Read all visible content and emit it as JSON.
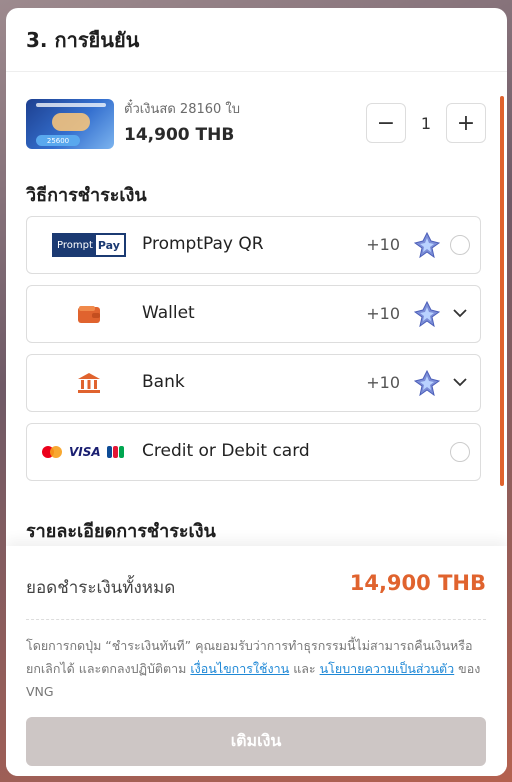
{
  "header": {
    "title": "3. การยืนยัน"
  },
  "product": {
    "name": "ตั๋วเงินสด 28160 ใบ",
    "price": "14,900 THB",
    "thumb_badge": "25600",
    "quantity": "1",
    "minus_label": "−",
    "plus_label": "+"
  },
  "payment": {
    "section_title": "วิธีการชำระเงิน",
    "methods": [
      {
        "label": "PromptPay QR",
        "bonus": "+10",
        "logo_text_a": "Prompt",
        "logo_text_b": "Pay",
        "control": "radio"
      },
      {
        "label": "Wallet",
        "bonus": "+10",
        "icon": "wallet-icon",
        "control": "chevron"
      },
      {
        "label": "Bank",
        "bonus": "+10",
        "icon": "bank-icon",
        "control": "chevron"
      },
      {
        "label": "Credit or Debit card",
        "logo_visa": "VISA",
        "control": "radio"
      }
    ]
  },
  "details": {
    "section_title": "รายละเอียดการชำระเงิน"
  },
  "footer": {
    "total_label": "ยอดชำระเงินทั้งหมด",
    "total_value": "14,900 THB",
    "terms_1": "โดยการกดปุ่ม “ชำระเงินทันที” คุณยอมรับว่าการทำธุรกรรมนี้ไม่สามารถคืนเงินหรือยกเลิกได้ และตกลงปฏิบัติตาม ",
    "terms_link_1": "เงื่อนไขการใช้งาน",
    "terms_2": " และ ",
    "terms_link_2": "นโยบายความเป็นส่วนตัว",
    "terms_3": " ของ VNG",
    "button_label": "เติมเงิน"
  },
  "colors": {
    "accent": "#e0632e",
    "link": "#1e88d6",
    "button_disabled": "#cdc6c5"
  }
}
